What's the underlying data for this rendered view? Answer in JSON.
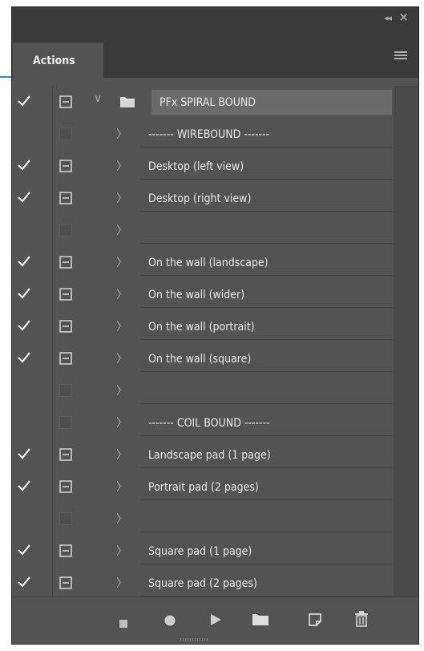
{
  "window": {
    "collapse_icon": "double-chevron-left-icon",
    "close_icon": "close-x-icon"
  },
  "panel": {
    "tab_label": "Actions",
    "menu_icon": "panel-menu-icon"
  },
  "set": {
    "name": "PFx SPIRAL BOUND",
    "enabled": true,
    "dialog": true,
    "expanded": true
  },
  "actions": [
    {
      "label": "------- WIREBOUND -------",
      "checked": false,
      "dialog": false
    },
    {
      "label": "Desktop (left view)",
      "checked": true,
      "dialog": true
    },
    {
      "label": "Desktop (right view)",
      "checked": true,
      "dialog": true
    },
    {
      "label": "",
      "checked": false,
      "dialog": false
    },
    {
      "label": "On the wall (landscape)",
      "checked": true,
      "dialog": true
    },
    {
      "label": "On the wall (wider)",
      "checked": true,
      "dialog": true
    },
    {
      "label": "On the wall (portrait)",
      "checked": true,
      "dialog": true
    },
    {
      "label": "On the wall (square)",
      "checked": true,
      "dialog": true
    },
    {
      "label": "",
      "checked": false,
      "dialog": false
    },
    {
      "label": "------- COIL BOUND -------",
      "checked": false,
      "dialog": false
    },
    {
      "label": "Landscape pad (1 page)",
      "checked": true,
      "dialog": true
    },
    {
      "label": "Portrait pad (2 pages)",
      "checked": true,
      "dialog": true
    },
    {
      "label": "",
      "checked": false,
      "dialog": false
    },
    {
      "label": "Square pad (1 page)",
      "checked": true,
      "dialog": true
    },
    {
      "label": "Square pad (2 pages)",
      "checked": true,
      "dialog": true
    }
  ],
  "toolbar": [
    "stop-icon",
    "record-icon",
    "play-icon",
    "new-set-folder-icon",
    "new-action-icon",
    "trash-icon"
  ],
  "colors": {
    "panel_bg": "#535353",
    "header_bg": "#393939",
    "row_label_bg": "#6a6a6a",
    "accent": "#2d8ad6"
  }
}
